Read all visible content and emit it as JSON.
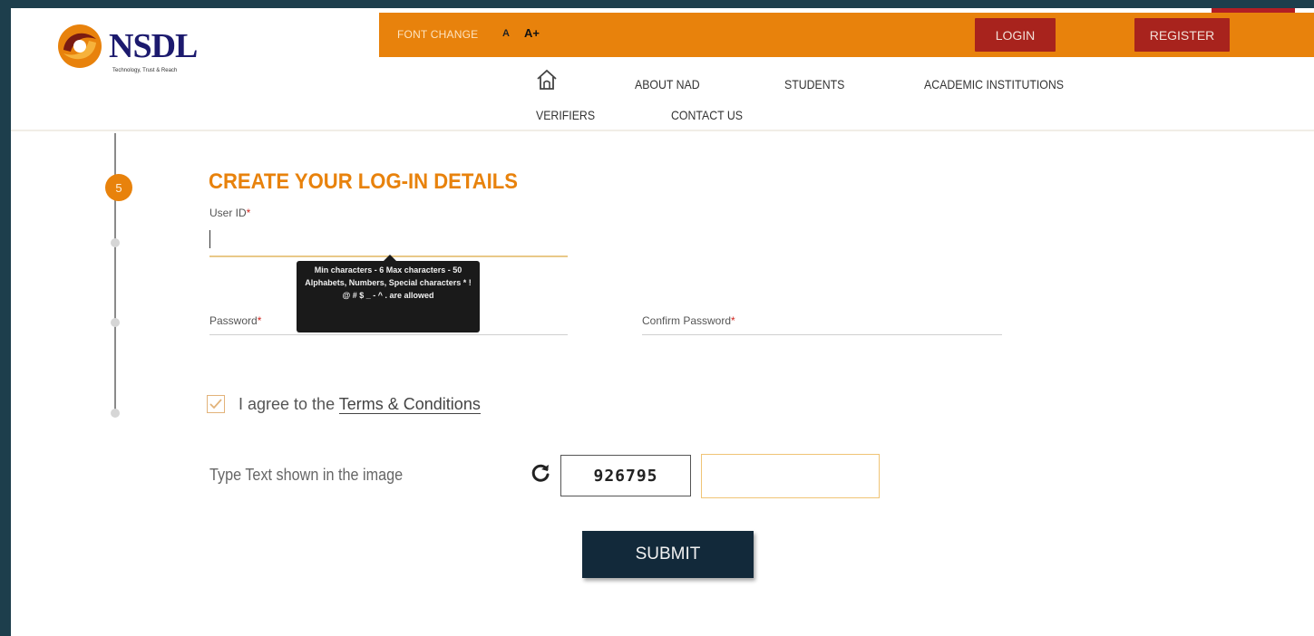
{
  "header": {
    "logo_text": "NSDL",
    "logo_tagline": "Technology, Trust & Reach",
    "font_change_label": "FONT CHANGE",
    "font_small": "A",
    "font_large": "A+",
    "login_label": "LOGIN",
    "register_label": "REGISTER",
    "nav": {
      "about": "ABOUT NAD",
      "students": "STUDENTS",
      "institutions": "ACADEMIC INSTITUTIONS",
      "verifiers": "VERIFIERS",
      "contact": "CONTACT US"
    }
  },
  "stepper": {
    "current_step": "5"
  },
  "form": {
    "title": "CREATE YOUR LOG-IN DETAILS",
    "user_id_label": "User ID",
    "user_id_value": "",
    "password_label": "Password",
    "confirm_password_label": "Confirm Password",
    "required_mark": "*",
    "tooltip": "Min characters - 6 Max characters - 50 Alphabets, Numbers, Special characters * ! @ # $ _ - ^ . are allowed",
    "agree_prefix": "I agree to the ",
    "terms_link": "Terms & Conditions",
    "agree_checked": true,
    "captcha_label": "Type Text shown in the image",
    "captcha_code": "926795",
    "captcha_value": "",
    "submit_label": "SUBMIT"
  },
  "colors": {
    "accent_orange": "#e8820c",
    "button_red": "#a8231d",
    "navy": "#12293a",
    "background": "#1d3e4c"
  },
  "icons": [
    "home-icon",
    "refresh-icon",
    "check-icon",
    "nsdl-logo-mark"
  ]
}
